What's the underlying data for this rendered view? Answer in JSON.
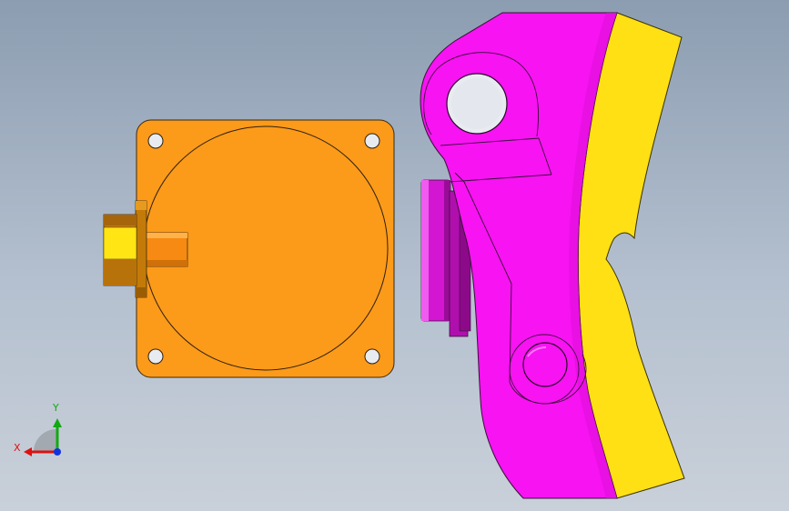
{
  "viewport": {
    "background_top": "#8c9db1",
    "background_bottom": "#c9d0d9"
  },
  "parts": {
    "sensor_body_color": "#fc9a1a",
    "connector_face_color": "#ffe514",
    "connector_shadow_color": "#c37a08",
    "bracket_color": "#f713f2",
    "bracket_shadow_color": "#b00fae",
    "pad_color": "#ffe014"
  },
  "triad": {
    "x_label": "X",
    "y_label": "Y",
    "x_color": "#dd1111",
    "y_color": "#11aa11",
    "z_color": "#1133dd"
  }
}
